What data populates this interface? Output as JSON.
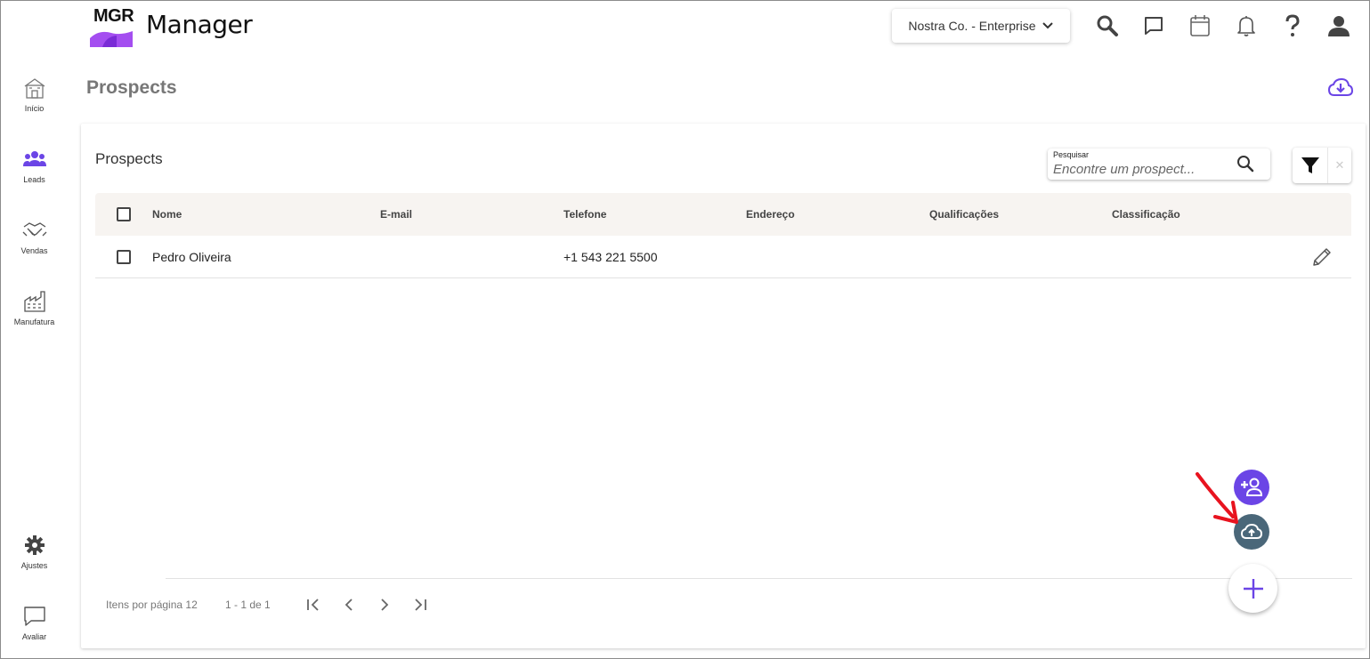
{
  "header": {
    "logo_text": "MGR",
    "app_name": "Manager",
    "company_selector": "Nostra Co. - Enterprise",
    "icons": [
      "search-icon",
      "chat-icon",
      "calendar-icon",
      "bell-icon",
      "help-icon",
      "user-icon"
    ]
  },
  "sidebar": {
    "items": [
      {
        "label": "Início",
        "icon": "home-icon"
      },
      {
        "label": "Leads",
        "icon": "people-icon"
      },
      {
        "label": "Vendas",
        "icon": "handshake-icon"
      },
      {
        "label": "Manufatura",
        "icon": "factory-icon"
      },
      {
        "label": "Ajustes",
        "icon": "gear-icon"
      },
      {
        "label": "Avaliar",
        "icon": "feedback-icon"
      }
    ]
  },
  "page": {
    "title": "Prospects"
  },
  "card": {
    "title": "Prospects",
    "search": {
      "label": "Pesquisar",
      "placeholder": "Encontre um prospect..."
    },
    "filter_clear": "✕"
  },
  "table": {
    "columns": [
      "Nome",
      "E-mail",
      "Telefone",
      "Endereço",
      "Qualificações",
      "Classificação"
    ],
    "rows": [
      {
        "nome": "Pedro Oliveira",
        "email": "",
        "telefone": "+1 543 221 5500",
        "endereco": "",
        "qualificacoes": "",
        "classificacao": ""
      }
    ]
  },
  "pager": {
    "items_per_page": "Itens por página 12",
    "range": "1 - 1 de 1"
  },
  "colors": {
    "accent": "#6b45e6",
    "upload_fab": "#4a6779",
    "annotation_arrow": "#e8131f"
  }
}
